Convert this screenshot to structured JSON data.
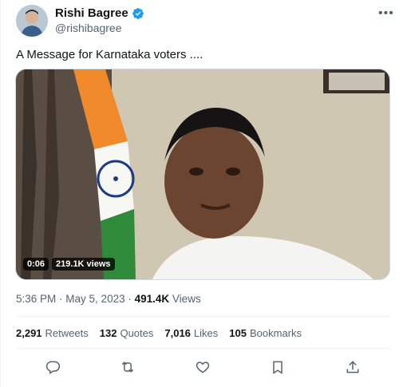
{
  "tweet": {
    "author_name": "Rishi Bagree",
    "author_handle": "@rishibagree",
    "text": "A Message for Karnataka voters ....",
    "video": {
      "time": "0:06",
      "views": "219.1K views"
    },
    "meta": {
      "time": "5:36 PM",
      "date": "May 5, 2023",
      "views_count": "491.4K",
      "views_label": "Views"
    },
    "stats": [
      {
        "num": "2,291",
        "label": "Retweets"
      },
      {
        "num": "132",
        "label": "Quotes"
      },
      {
        "num": "7,016",
        "label": "Likes"
      },
      {
        "num": "105",
        "label": "Bookmarks"
      }
    ]
  },
  "icons": [
    "verified-badge-icon",
    "more-icon",
    "reply-icon",
    "retweet-icon",
    "like-icon",
    "bookmark-icon",
    "share-icon"
  ],
  "colors": {
    "accent": "#1d9bf0",
    "muted": "#536471",
    "text": "#0f1419"
  }
}
